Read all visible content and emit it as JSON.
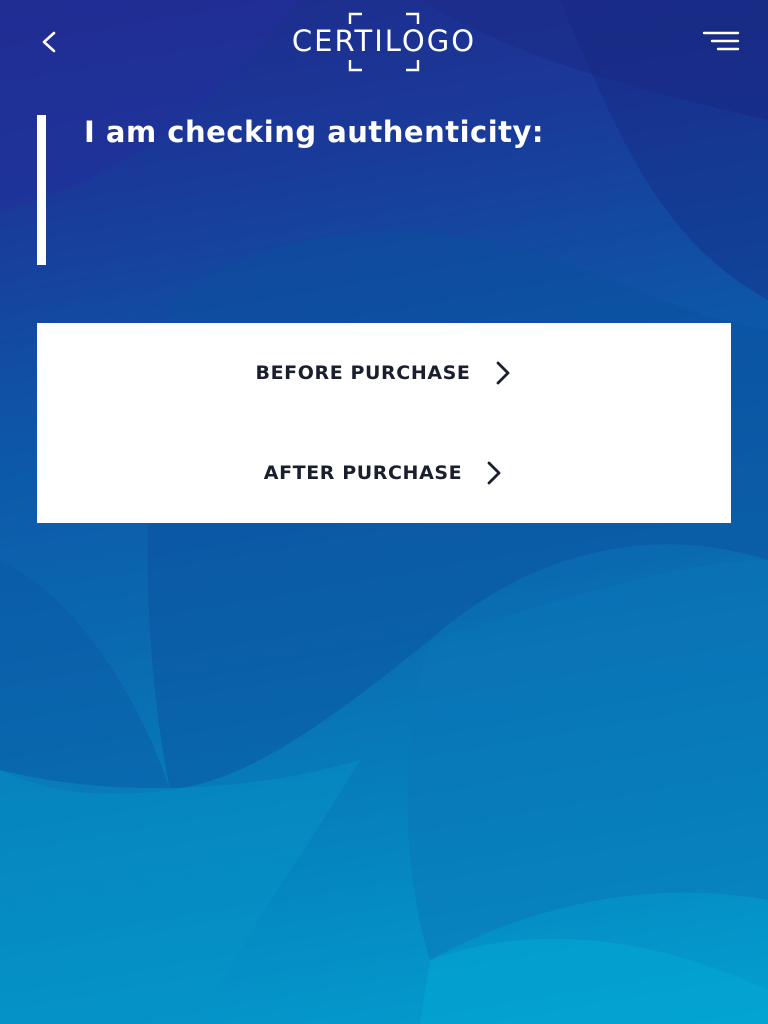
{
  "header": {
    "back_icon": "chevron-left-icon",
    "logo_text": "CERTILOGO",
    "menu_icon": "hamburger-menu-icon"
  },
  "main": {
    "heading": "I am checking authenticity:",
    "options": [
      {
        "label": "BEFORE PURCHASE",
        "icon": "chevron-right-icon"
      },
      {
        "label": "AFTER PURCHASE",
        "icon": "chevron-right-icon"
      }
    ]
  },
  "colors": {
    "background_top": "#1e2a8a",
    "background_bottom": "#03a0cf",
    "panel": "#ffffff",
    "option_text": "#1a1f2e",
    "heading_text": "#ffffff"
  }
}
